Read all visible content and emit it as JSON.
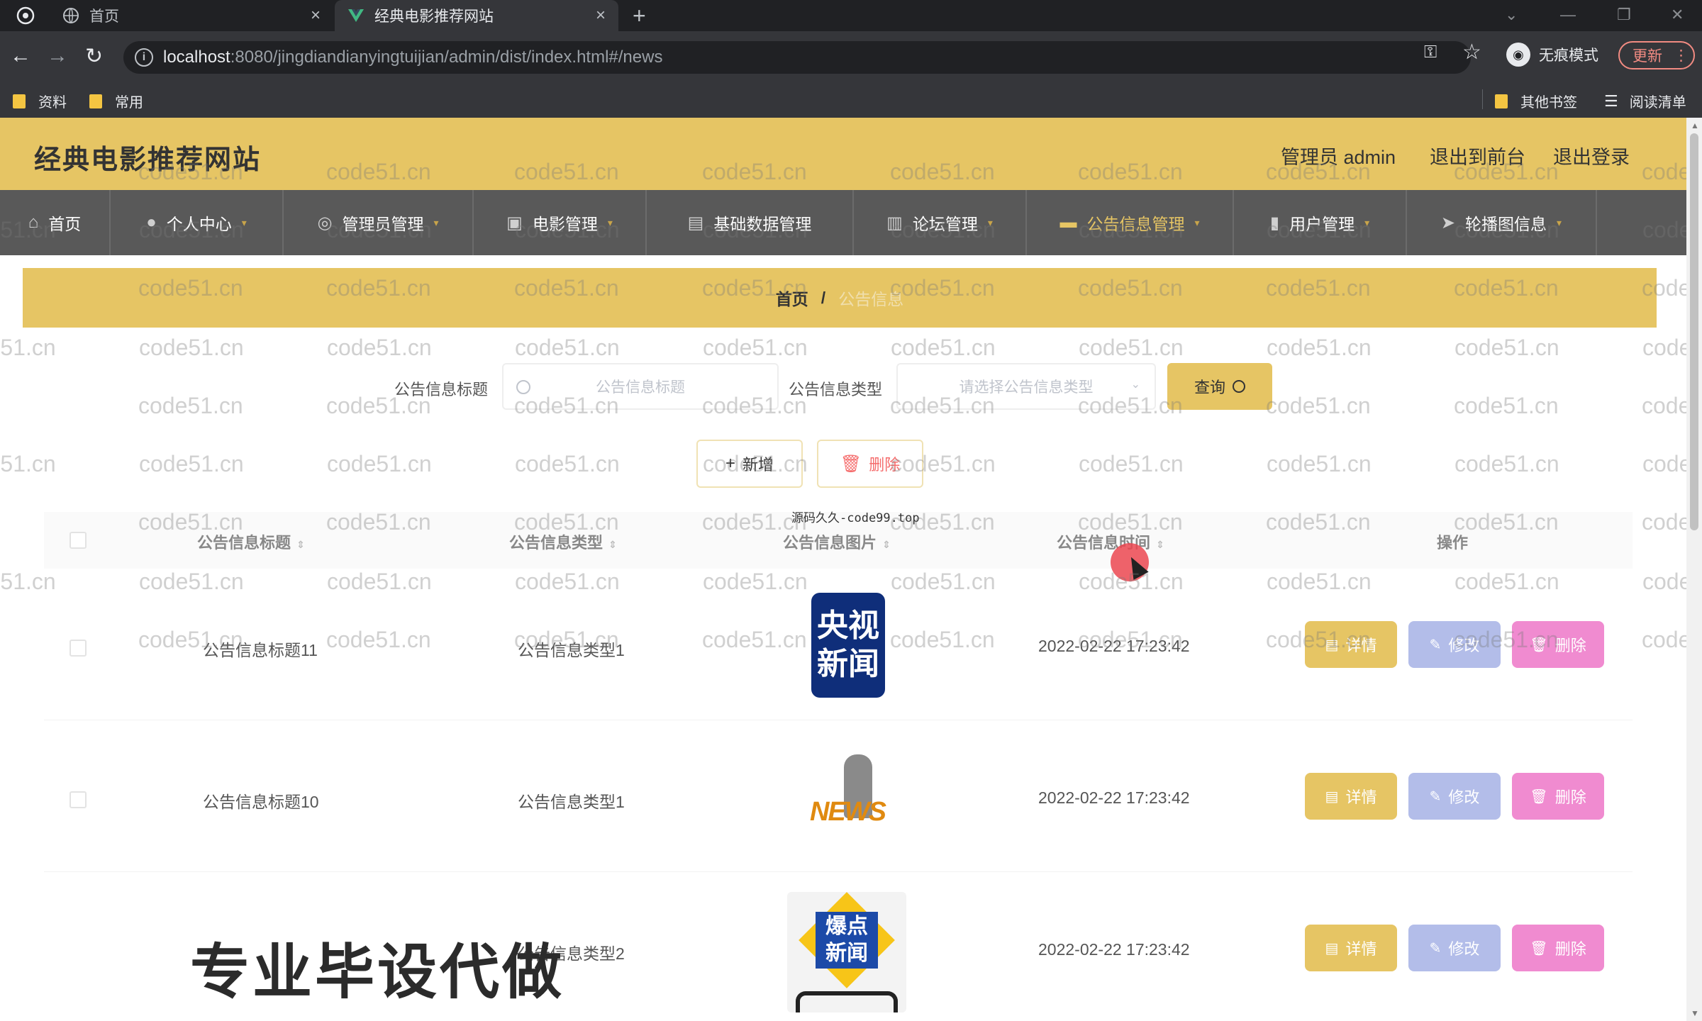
{
  "browser": {
    "tabs": [
      {
        "title": "首页",
        "active": false
      },
      {
        "title": "经典电影推荐网站",
        "active": true
      }
    ],
    "url_host": "localhost",
    "url_path": ":8080/jingdiandianyingtuijian/admin/dist/index.html#/news",
    "incognito_label": "无痕模式",
    "update_label": "更新",
    "bookmarks": [
      "资料",
      "常用"
    ],
    "bookmarks_right": [
      "其他书签",
      "阅读清单"
    ]
  },
  "header": {
    "site_title": "经典电影推荐网站",
    "admin_label": "管理员 admin",
    "to_front": "退出到前台",
    "logout": "退出登录"
  },
  "menu": [
    {
      "label": "首页",
      "icon": "home-icon",
      "caret": false,
      "active": false
    },
    {
      "label": "个人中心",
      "icon": "user-icon",
      "caret": true,
      "active": false
    },
    {
      "label": "管理员管理",
      "icon": "admin-icon",
      "caret": true,
      "active": false
    },
    {
      "label": "电影管理",
      "icon": "film-icon",
      "caret": true,
      "active": false
    },
    {
      "label": "基础数据管理",
      "icon": "data-icon",
      "caret": true,
      "active": false
    },
    {
      "label": "论坛管理",
      "icon": "forum-icon",
      "caret": true,
      "active": false
    },
    {
      "label": "公告信息管理",
      "icon": "notice-icon",
      "caret": true,
      "active": true
    },
    {
      "label": "用户管理",
      "icon": "chart-icon",
      "caret": true,
      "active": false
    },
    {
      "label": "轮播图信息",
      "icon": "send-icon",
      "caret": true,
      "active": false
    }
  ],
  "breadcrumb": {
    "home": "首页",
    "sep": "/",
    "current": "公告信息"
  },
  "search": {
    "title_label": "公告信息标题",
    "title_placeholder": "公告信息标题",
    "type_label": "公告信息类型",
    "type_placeholder": "请选择公告信息类型",
    "query_label": "查询"
  },
  "actions": {
    "add": "新增",
    "delete": "删除"
  },
  "note": "源码久久-code99.top",
  "table": {
    "headers": [
      "公告信息标题",
      "公告信息类型",
      "公告信息图片",
      "公告信息时间",
      "操作"
    ],
    "rows": [
      {
        "title": "公告信息标题11",
        "type": "公告信息类型1",
        "image": "cctv-news",
        "image_text": "央视新闻",
        "time": "2022-02-22 17:23:42"
      },
      {
        "title": "公告信息标题10",
        "type": "公告信息类型1",
        "image": "news-figure",
        "image_text": "NEWS",
        "time": "2022-02-22 17:23:42"
      },
      {
        "title": "",
        "type": "公告信息类型2",
        "image": "burst-news",
        "image_text": "爆点新闻",
        "time": "2022-02-22 17:23:42"
      }
    ],
    "row_buttons": {
      "detail": "详情",
      "edit": "修改",
      "delete": "删除"
    }
  },
  "overlay_text": "专业毕设代做",
  "watermark_text": "code51.cn",
  "colors": {
    "accent": "#e6c564",
    "menu_bg": "#595959",
    "edit": "#b3bde9",
    "delete": "#f08bd0"
  }
}
